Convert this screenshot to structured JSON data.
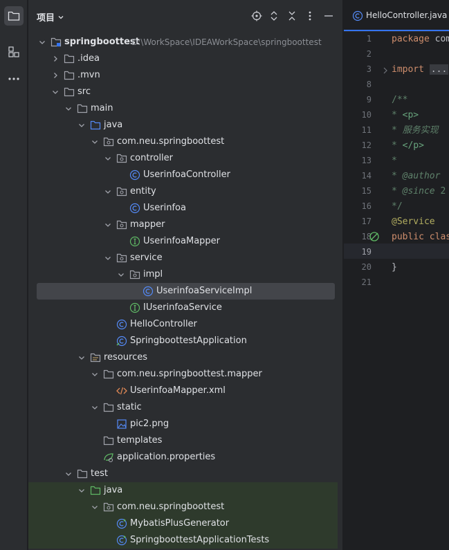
{
  "toolwindow": {
    "title": "项目"
  },
  "editor": {
    "tab_label": "HelloController.java",
    "line_numbers": [
      "1",
      "2",
      "3",
      "8",
      "9",
      "10",
      "11",
      "12",
      "13",
      "14",
      "15",
      "16",
      "17",
      "18",
      "19",
      "20",
      "21"
    ],
    "code": {
      "l1_kw": "package",
      "l1_rest": " com",
      "l3_kw": "import",
      "l3_fold": "...",
      "l9": "/**",
      "l10_star": " * ",
      "l10_tag": "<p>",
      "l11_star": " *  ",
      "l11_text": "服务实现",
      "l12_star": " * ",
      "l12_tag": "</p>",
      "l13": " *",
      "l14_star": " * ",
      "l14_tag": "@author",
      "l15_star": " * ",
      "l15_tag": "@since",
      "l15_rest": " 2",
      "l16": " */",
      "l17": "@Service",
      "l18_kw": "public",
      "l18_rest": " clas",
      "l20": "}"
    }
  },
  "tree": {
    "root": {
      "name": "springboottest",
      "path": "D:\\WorkSpace\\IDEAWorkSpace\\springboottest"
    },
    "items": [
      {
        "label": ".idea"
      },
      {
        "label": ".mvn"
      },
      {
        "label": "src"
      },
      {
        "label": "main"
      },
      {
        "label": "java"
      },
      {
        "label": "com.neu.springboottest"
      },
      {
        "label": "controller"
      },
      {
        "label": "UserinfoaController"
      },
      {
        "label": "entity"
      },
      {
        "label": "Userinfoa"
      },
      {
        "label": "mapper"
      },
      {
        "label": "UserinfoaMapper"
      },
      {
        "label": "service"
      },
      {
        "label": "impl"
      },
      {
        "label": "UserinfoaServiceImpl"
      },
      {
        "label": "IUserinfoaService"
      },
      {
        "label": "HelloController"
      },
      {
        "label": "SpringboottestApplication"
      },
      {
        "label": "resources"
      },
      {
        "label": "com.neu.springboottest.mapper"
      },
      {
        "label": "UserinfoaMapper.xml"
      },
      {
        "label": "static"
      },
      {
        "label": "pic2.png"
      },
      {
        "label": "templates"
      },
      {
        "label": "application.properties"
      },
      {
        "label": "test"
      },
      {
        "label": "java"
      },
      {
        "label": "com.neu.springboottest"
      },
      {
        "label": "MybatisPlusGenerator"
      },
      {
        "label": "SpringboottestApplicationTests"
      }
    ]
  },
  "colors": {
    "accent": "#3574f0",
    "folder": "#a1a3ab",
    "class_icon": "#548af7",
    "interface_icon": "#5fb865",
    "keyword": "#cf8e6d",
    "comment": "#5f826b",
    "annotation": "#b3ae60"
  },
  "icons": {
    "rail": [
      "folder-icon",
      "structure-icon",
      "more-icon"
    ],
    "header": [
      "locate-icon",
      "expand-all-icon",
      "collapse-all-icon",
      "options-icon",
      "hide-icon"
    ]
  }
}
